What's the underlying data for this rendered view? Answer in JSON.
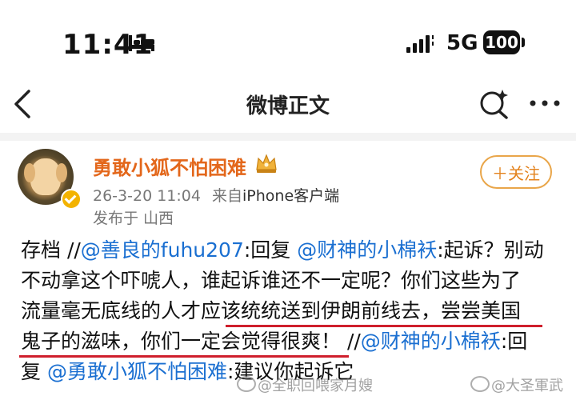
{
  "status_bar": {
    "time": "11:41",
    "network": "5G",
    "battery": "100"
  },
  "nav": {
    "title": "微博正文"
  },
  "post": {
    "author": "勇敢小狐不怕困难",
    "timestamp": "26-3-20 11:04",
    "source_prefix": "来自",
    "source_device": "iPhone客户端",
    "location": "发布于 山西",
    "follow_label": "＋关注",
    "lines": [
      [
        {
          "t": "存档 //"
        },
        {
          "t": "@善良的fuhu207",
          "m": true
        },
        {
          "t": ":回复 "
        },
        {
          "t": "@财神的小棉袄",
          "m": true
        },
        {
          "t": ":起诉？别动"
        }
      ],
      [
        {
          "t": "不动拿这个吓唬人，谁起诉谁还不一定呢？你们这些为了"
        }
      ],
      [
        {
          "t": "流量毫无底线的人才应该统统送到伊朗前线去，尝尝美国"
        }
      ],
      [
        {
          "t": "鬼子的滋味，你们一定会觉得很爽！ //"
        },
        {
          "t": "@财神的小棉袄",
          "m": true
        },
        {
          "t": ":回"
        }
      ],
      [
        {
          "t": "复 "
        },
        {
          "t": "@勇敢小狐不怕困难",
          "m": true
        },
        {
          "t": ":建议你起诉它"
        }
      ]
    ]
  },
  "watermarks": {
    "left": "@全职回喂家月嫂",
    "right": "@大圣軍武"
  },
  "colors": {
    "username": "#e3671b",
    "mention": "#1a6fd1",
    "underline": "#cf1f2c",
    "follow_border": "#e9a64a"
  }
}
